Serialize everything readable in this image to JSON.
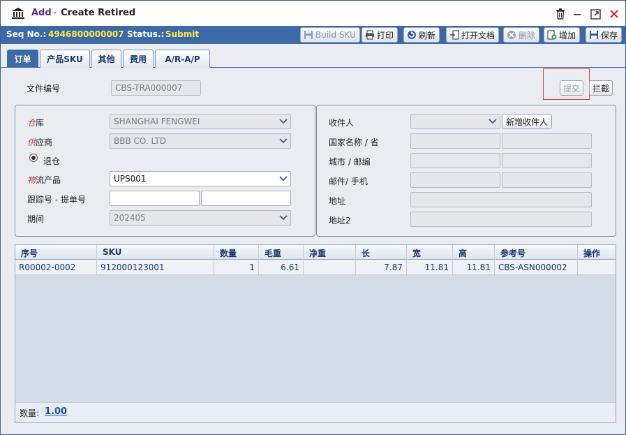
{
  "window": {
    "title_prefix": "Add",
    "title_separator": "-",
    "title": "Create Retired",
    "icons": {
      "app": "bank-icon",
      "delete": "trash-icon",
      "minimize": "minimize-icon",
      "maximize": "maximize-icon",
      "close": "close-icon"
    }
  },
  "infobar": {
    "seq_label": "Seq No.:",
    "seq_value": "4946800000007",
    "status_label": "Status.:",
    "status_value": "Submit"
  },
  "toolbar": {
    "build_sku": "Build SKU",
    "print": "打印",
    "refresh": "刷新",
    "open_doc": "打开文档",
    "delete": "删除",
    "add": "增加",
    "save": "保存"
  },
  "tabs": [
    "订单",
    "产品SKU",
    "其他",
    "费用",
    "A/R-A/P"
  ],
  "doc": {
    "label": "文件编号",
    "value": "CBS-TRA000007",
    "submit_button": "提交",
    "block_button": "拦截"
  },
  "left_form": {
    "warehouse": {
      "req": "仓",
      "label": "库",
      "value": "SHANGHAI FENGWEI"
    },
    "supplier": {
      "req": "供",
      "label": "应商",
      "value": "BBB CO. LTD"
    },
    "return_radio": "退仓",
    "logistics": {
      "req": "物",
      "label": "流产品",
      "value": "UPS001"
    },
    "tracking": {
      "label": "跟踪号 - 提单号",
      "value1": "",
      "value2": ""
    },
    "period": {
      "label": "期间",
      "value": "202405"
    }
  },
  "right_form": {
    "recipient": {
      "label": "收件人",
      "value": "",
      "add_button": "新增收件人"
    },
    "country": {
      "label": "国家名称 / 省"
    },
    "city": {
      "label": "城市 / 邮编"
    },
    "email": {
      "label": "邮件/ 手机"
    },
    "address": {
      "label": "地址"
    },
    "address2": {
      "label": "地址2"
    }
  },
  "grid": {
    "columns": [
      "序号",
      "SKU",
      "数量",
      "毛重",
      "净重",
      "长",
      "宽",
      "高",
      "参考号",
      "操作"
    ],
    "rows": [
      [
        "R00002-0002",
        "912000123001",
        "1",
        "6.61",
        "",
        "7.87",
        "11.81",
        "11.81",
        "CBS-ASN000002",
        ""
      ]
    ],
    "footer_label": "数量:",
    "footer_value": "1.00"
  },
  "colors": {
    "accent": "#3d69a6",
    "status_yellow": "#ffe94a",
    "title_purple": "#5a2b85",
    "required_red": "#c0392b"
  }
}
